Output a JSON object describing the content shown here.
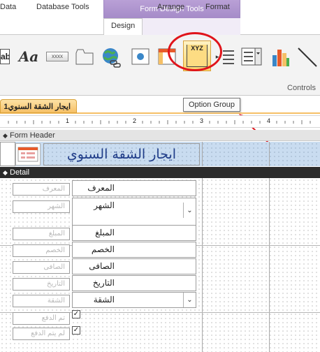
{
  "ribbon": {
    "context_title": "Form Design Tools",
    "tabs": [
      "Data",
      "Database Tools",
      "Design",
      "Arrange",
      "Format"
    ],
    "active_tab": "Design",
    "group_label": "Controls",
    "controls": {
      "text_box_label": "ab|",
      "label_text": "Aa",
      "button_text": "xxxx",
      "option_group_text": "XYZ"
    }
  },
  "document": {
    "tab_title": "ايجار الشقة السنوي1",
    "tooltip": "Option Group",
    "ruler_numbers": [
      "1",
      "2",
      "3",
      "4"
    ]
  },
  "form_header": {
    "bar_label": "Form Header",
    "title": "ايجار الشقة السنوي"
  },
  "detail": {
    "bar_label": "Detail",
    "fields": [
      {
        "label": "المعرف",
        "value": "المعرف",
        "type": "text"
      },
      {
        "label": "الشهر",
        "value": "الشهر",
        "type": "combo"
      },
      {
        "label": "المبلغ",
        "value": "المبلغ",
        "type": "text"
      },
      {
        "label": "الخصم",
        "value": "الخصم",
        "type": "text"
      },
      {
        "label": "الصافى",
        "value": "الصافى",
        "type": "text"
      },
      {
        "label": "التاريخ",
        "value": "التاريخ",
        "type": "text"
      },
      {
        "label": "الشقة",
        "value": "الشقة",
        "type": "combo"
      },
      {
        "label": "تم الدفع",
        "type": "checkbox"
      },
      {
        "label": "لم يتم الدفع",
        "type": "checkbox"
      }
    ]
  },
  "colors": {
    "context_tab": "#a58bc8",
    "doc_tab": "#f6c066",
    "header_band": "#c9dcf0",
    "detail_bar": "#2b2b2b",
    "highlight_circle": "#e0141b",
    "arrow": "#e0141b"
  }
}
